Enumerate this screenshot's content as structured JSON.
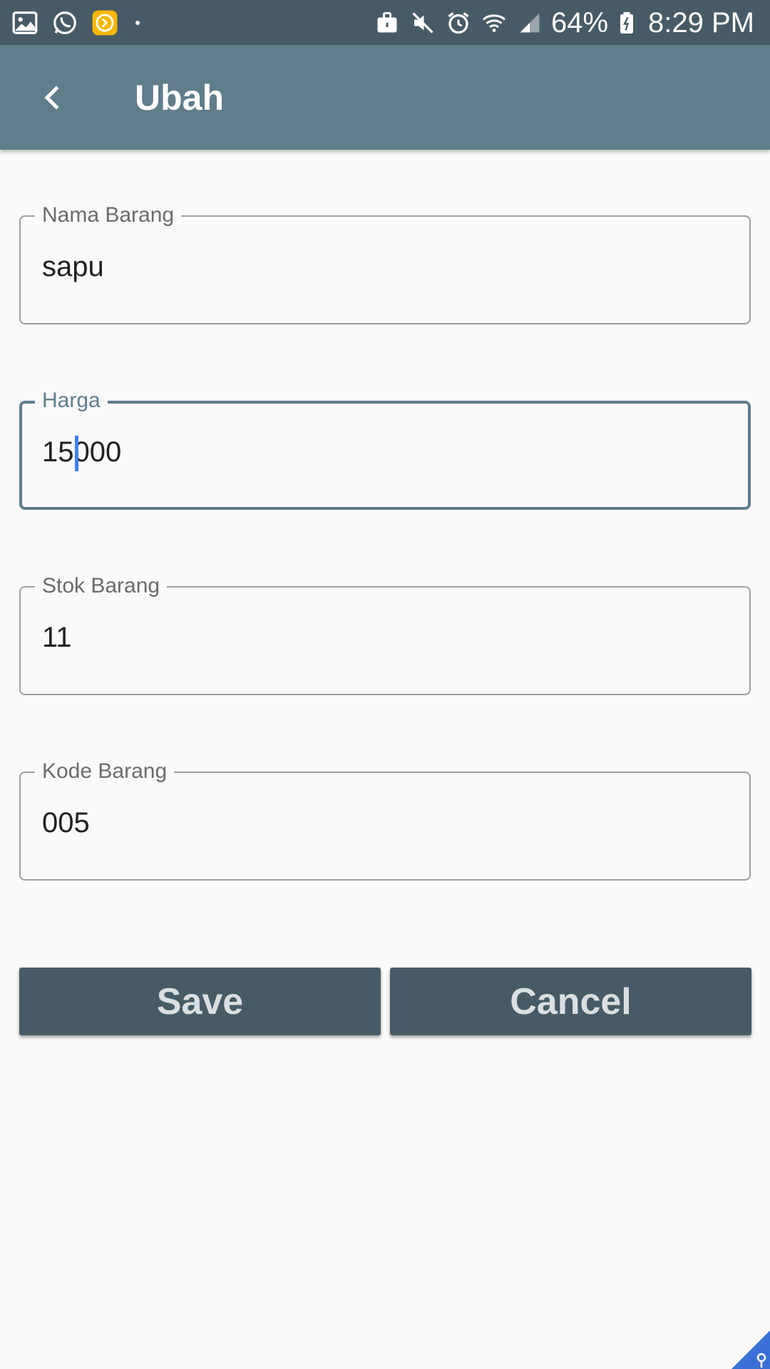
{
  "status_bar": {
    "battery": "64%",
    "time": "8:29 PM",
    "left_icons": [
      "image-icon",
      "whatsapp-icon",
      "app-arrow-icon",
      "notification-dot-icon"
    ],
    "right_icons": [
      "work-profile-icon",
      "mute-icon",
      "alarm-icon",
      "wifi-icon",
      "signal-icon",
      "battery-icon"
    ]
  },
  "app_bar": {
    "title": "Ubah",
    "back_icon": "chevron-left-icon",
    "color": "#607d8b"
  },
  "form": {
    "nama_barang": {
      "label": "Nama Barang",
      "value": "sapu"
    },
    "harga": {
      "label": "Harga",
      "value": "15000"
    },
    "stok_barang": {
      "label": "Stok Barang",
      "value": "11"
    },
    "kode_barang": {
      "label": "Kode Barang",
      "value": "005"
    }
  },
  "buttons": {
    "save": "Save",
    "cancel": "Cancel",
    "color": "#475b66"
  },
  "colors": {
    "status_bar": "#475b66",
    "background": "#fafafa",
    "caret": "#3f82ee"
  }
}
